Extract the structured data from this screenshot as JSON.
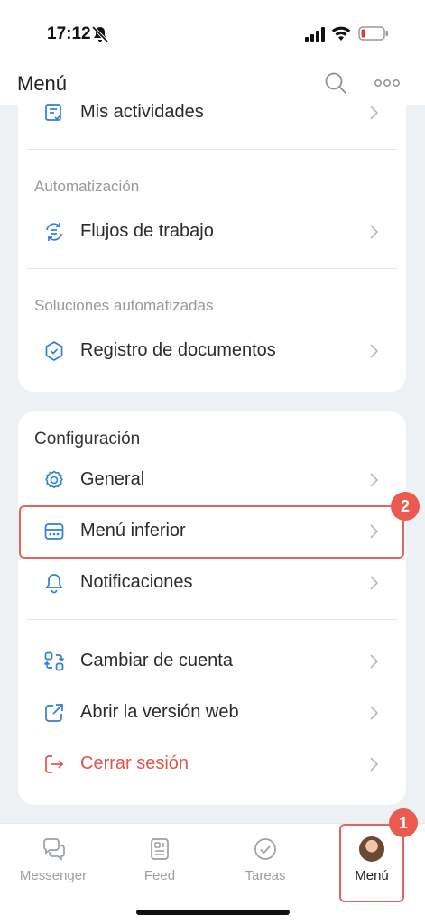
{
  "status_bar": {
    "time": "17:12"
  },
  "header": {
    "title": "Menú"
  },
  "top_card": {
    "my_activities": "Mis actividades",
    "automation_section": "Automatización",
    "workflows": "Flujos de trabajo",
    "solutions_section": "Soluciones automatizadas",
    "document_registry": "Registro de documentos"
  },
  "config_card": {
    "title": "Configuración",
    "general": "General",
    "bottom_menu": "Menú inferior",
    "notifications": "Notificaciones",
    "switch_account": "Cambiar de cuenta",
    "open_web": "Abrir la versión web",
    "logout": "Cerrar sesión"
  },
  "badges": {
    "first": "1",
    "second": "2"
  },
  "tabbar": {
    "messenger": "Messenger",
    "feed": "Feed",
    "tasks": "Tareas",
    "menu": "Menú"
  },
  "colors": {
    "accent": "#2f7fd8",
    "danger": "#e2534b",
    "highlight": "#e2645d"
  }
}
